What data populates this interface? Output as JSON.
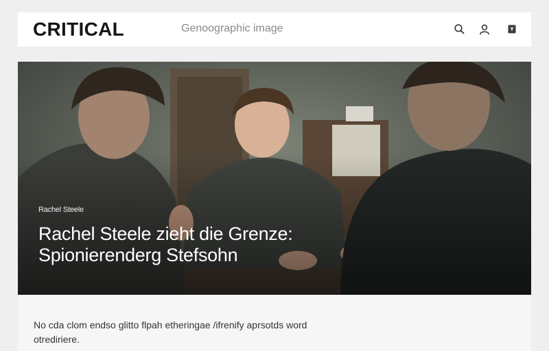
{
  "header": {
    "logo": "CRITICAL",
    "subtitle": "Genoographic image",
    "icons": [
      "search-icon",
      "user-icon",
      "bookmark-icon"
    ]
  },
  "hero": {
    "author": "Rachel Steele",
    "headline_line1": "Rachel Steele zieht die Grenze:",
    "headline_line2": "Spionierenderg Stefsohn"
  },
  "article": {
    "teaser_line1": "No cda clom endso glitto flpah etheringae /ifrenify aprsotds word",
    "teaser_line2": "otrediriere."
  }
}
